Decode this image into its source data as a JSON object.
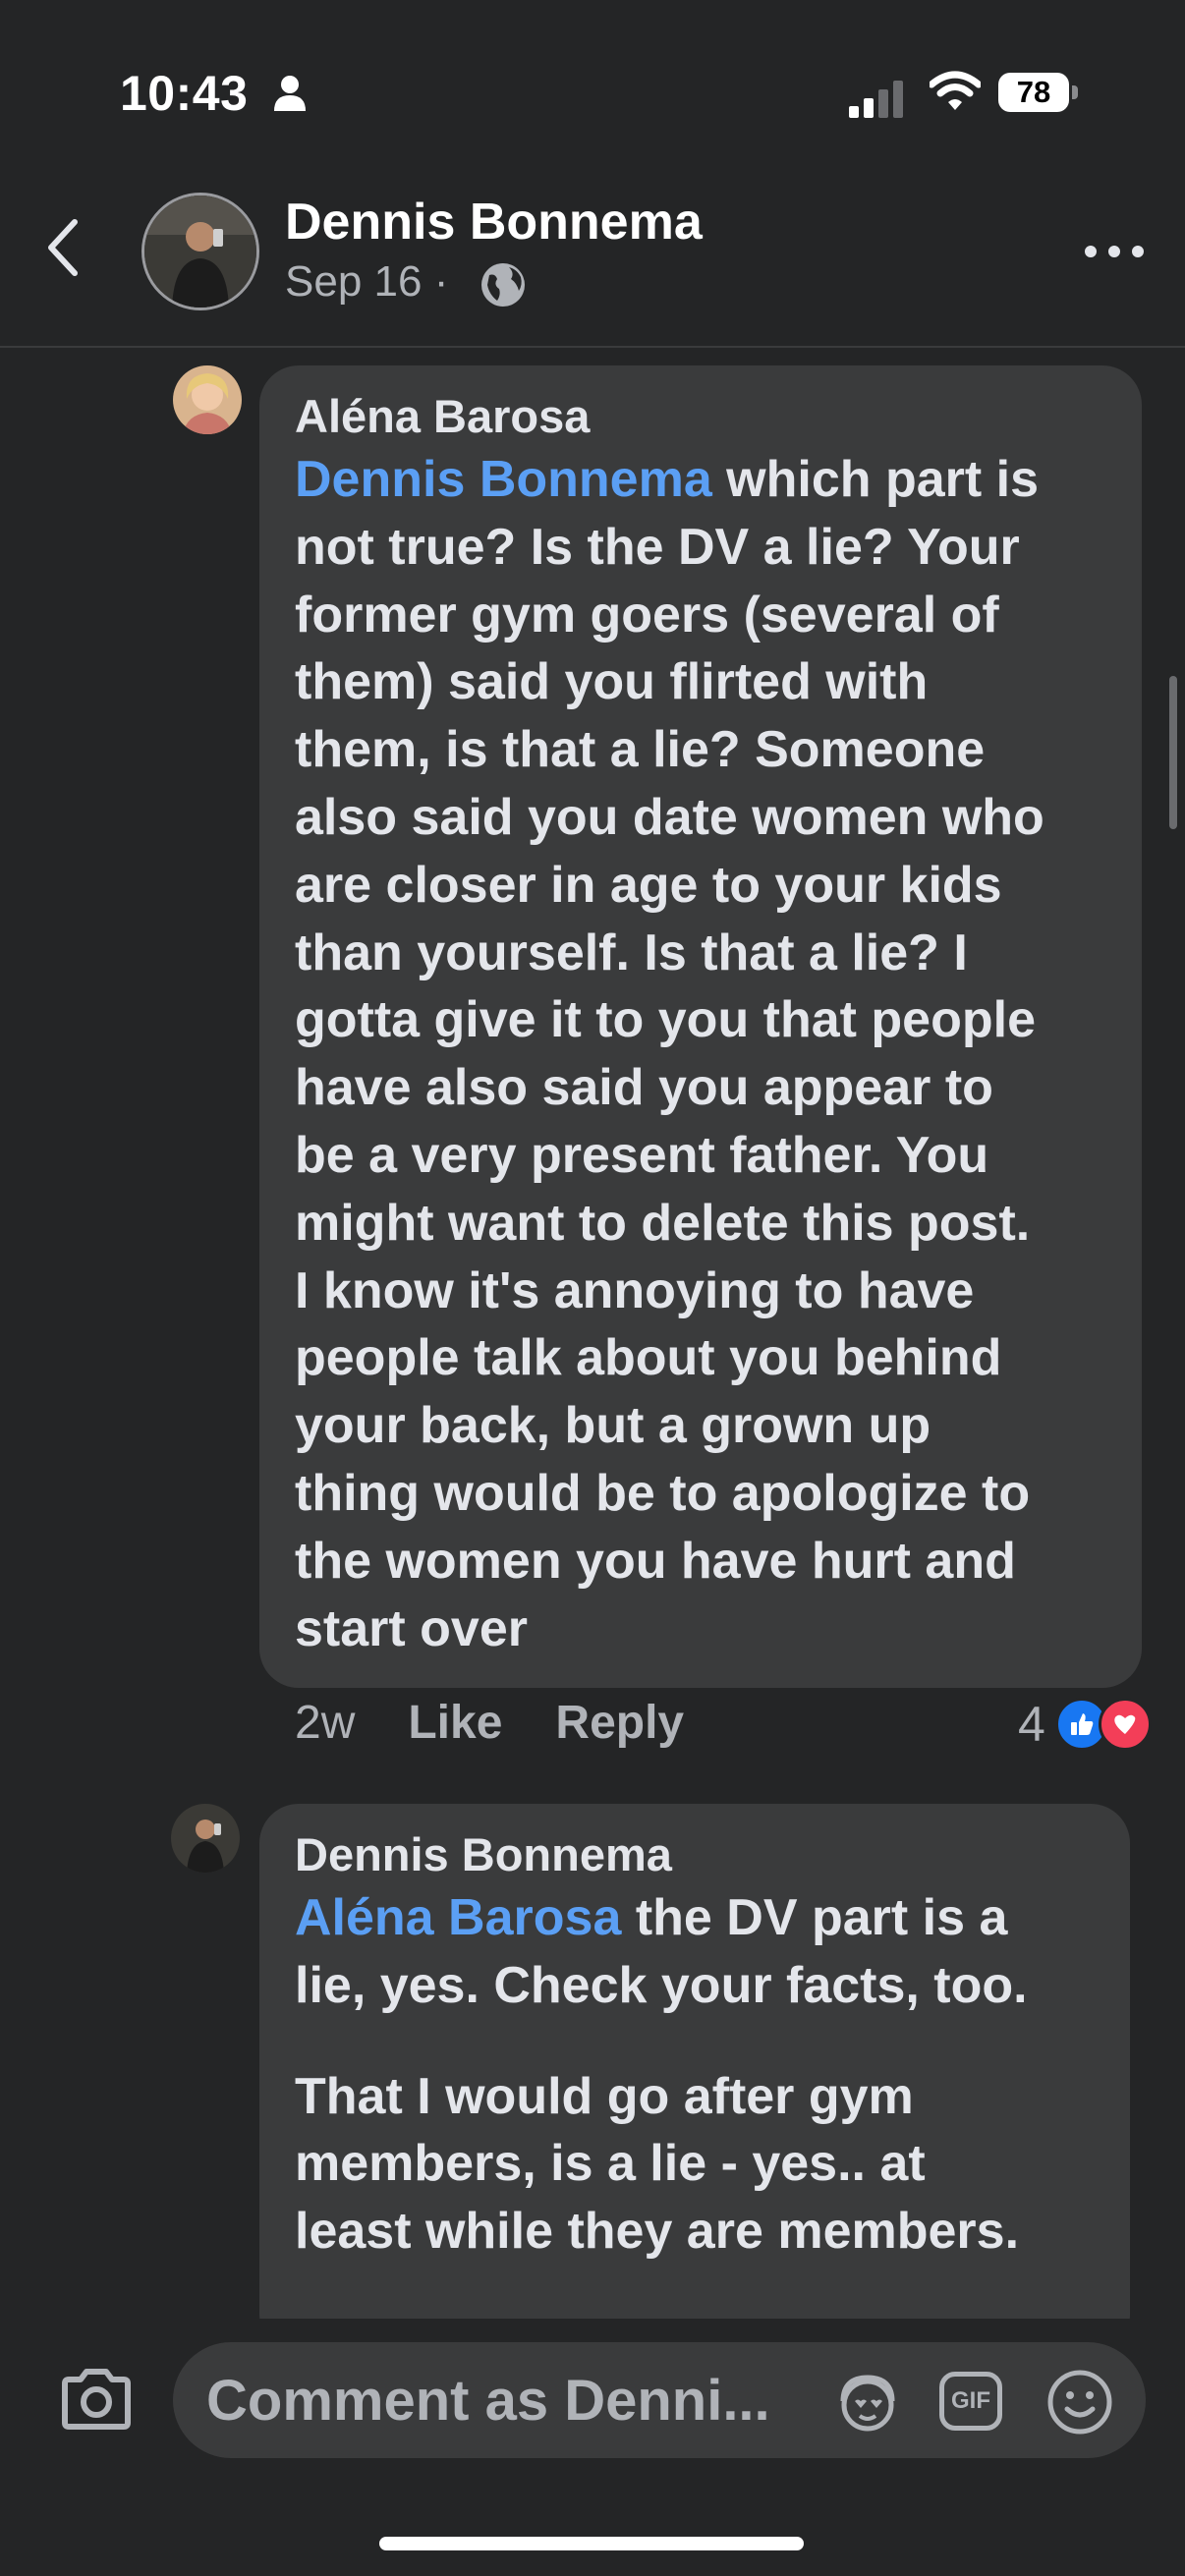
{
  "status_bar": {
    "time": "10:43",
    "battery": "78"
  },
  "header": {
    "name": "Dennis Bonnema",
    "date": "Sep 16",
    "separator": "·"
  },
  "comments": [
    {
      "author": "Aléna Barosa",
      "mention": "Dennis Bonnema",
      "lines": [
        " which part is",
        "not true? Is the DV a lie? Your",
        "former gym goers (several of",
        "them) said you flirted with",
        "them, is that a lie? Someone",
        "also said you date women who",
        "are closer in age to your kids",
        "than yourself. Is that a lie? I",
        "gotta give it to you that people",
        "have also said you appear to",
        "be a very present father. You",
        "might want to delete this post.",
        "I know it's annoying to have",
        "people talk about you behind",
        "your back, but a grown up",
        "thing would be to apologize to",
        "the women you have hurt and",
        "start over"
      ],
      "time": "2w",
      "like_label": "Like",
      "reply_label": "Reply",
      "reaction_count": "4",
      "reactions": [
        "like-icon",
        "love-icon"
      ]
    },
    {
      "author": "Dennis Bonnema",
      "mention": "Aléna Barosa",
      "lines_a": [
        " the DV part is a",
        "lie, yes. Check your facts, too."
      ],
      "lines_b": [
        "That I would go after gym",
        "members, is a lie - yes.. at",
        "least while they are members."
      ]
    }
  ],
  "composer": {
    "placeholder": "Comment as Denni...",
    "icons": [
      "camera-icon",
      "avatar-sticker-icon",
      "gif-icon",
      "emoji-icon"
    ],
    "gif_label": "GIF"
  },
  "colors": {
    "background": "#242526",
    "bubble": "#3a3b3c",
    "mention": "#5b9ff4",
    "like_blue": "#1877f2",
    "love_red": "#f33e58"
  }
}
